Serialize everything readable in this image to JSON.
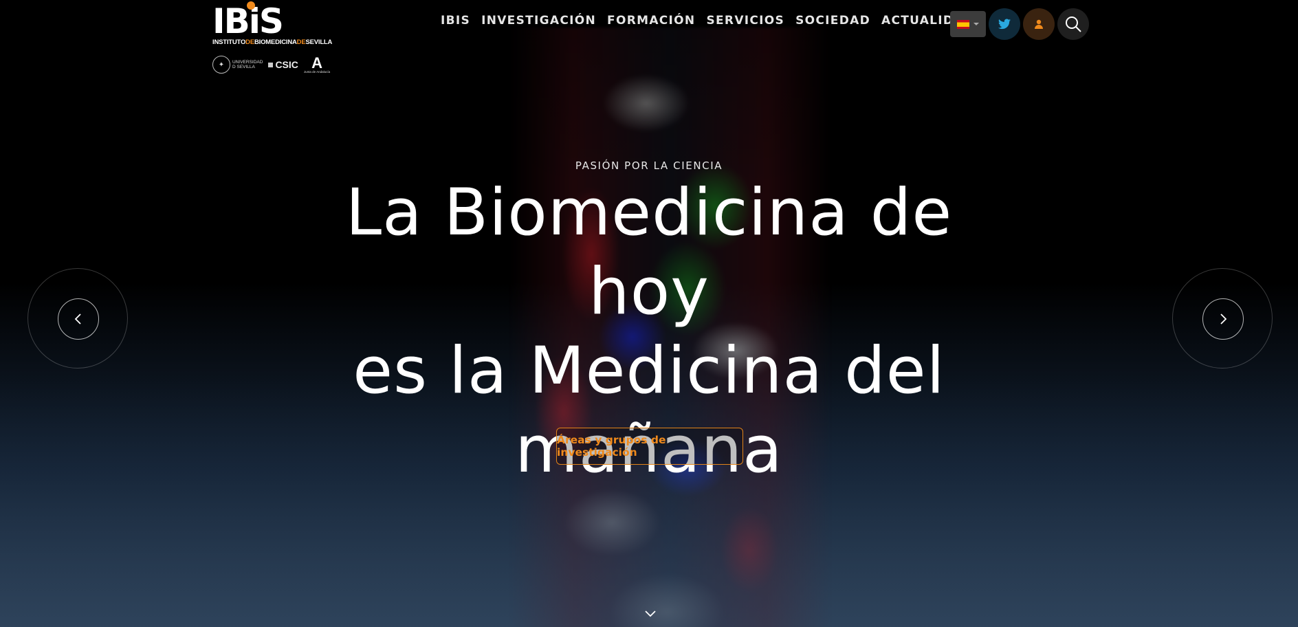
{
  "brand": {
    "logo_text": "IBiS",
    "logo_sub_parts": [
      "INSTITUTO",
      "DE",
      "BIOMEDICINA",
      "DE",
      "SEVILLA"
    ],
    "partners": {
      "us_line1": "UNIVERSIDAD",
      "us_line2": "D SEVILLA",
      "csic": "CSIC",
      "junta_letter": "A",
      "junta_text": "Junta de Andalucía"
    },
    "accent": "#f08a1c"
  },
  "nav": {
    "items": [
      "IBIS",
      "INVESTIGACIÓN",
      "FORMACIÓN",
      "SERVICIOS",
      "SOCIEDAD",
      "ACTUALIDAD"
    ]
  },
  "tools": {
    "language_icon": "spain-flag-icon",
    "twitter_icon": "twitter-icon",
    "user_icon": "user-icon",
    "search_icon": "search-icon",
    "twitter_color": "#2aa9e0",
    "user_color": "#f08a1c"
  },
  "hero": {
    "eyebrow": "PASIÓN POR LA CIENCIA",
    "headline_line1": "La Biomedicina de hoy",
    "headline_line2": "es la Medicina del",
    "headline_line3": "mañana",
    "cta_label": "Áreas y grupos de investigación"
  },
  "slider": {
    "prev_icon": "chevron-left-icon",
    "next_icon": "chevron-right-icon",
    "scroll_icon": "chevron-down-icon"
  }
}
